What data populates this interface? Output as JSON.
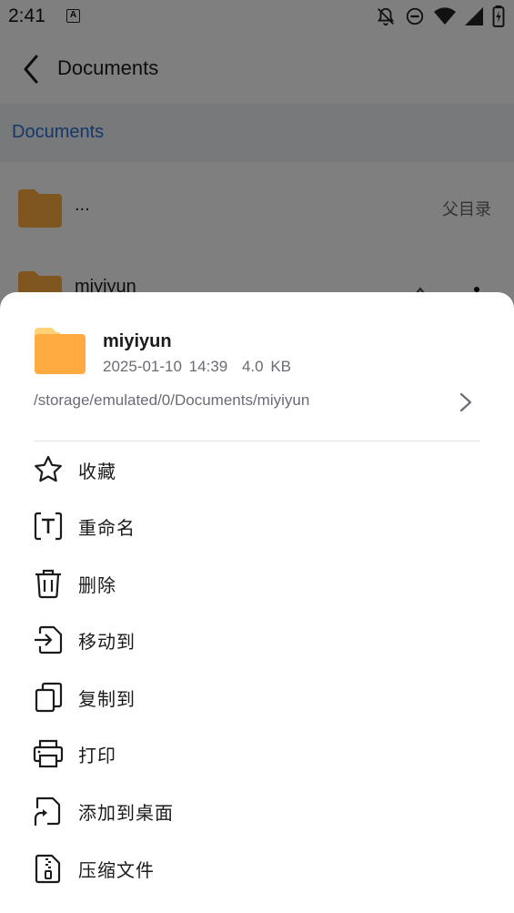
{
  "status_bar": {
    "time": "2:41",
    "notification_icon": "a-notification-icon",
    "icons": [
      "bell-off-icon",
      "dnd-icon",
      "wifi-icon",
      "signal-icon",
      "battery-icon"
    ]
  },
  "app_bar": {
    "title": "Documents",
    "back_icon": "back-arrow-icon"
  },
  "breadcrumb": {
    "current": "Documents"
  },
  "file_list": [
    {
      "name": "...",
      "trailing": "父目录"
    },
    {
      "name": "miyiyun",
      "trailing": ""
    }
  ],
  "sheet": {
    "name": "miyiyun",
    "date": "2025-01-10 14:39",
    "size": "4.0 KB",
    "path": "/storage/emulated/0/Documents/miyiyun",
    "items": [
      {
        "label": "收藏",
        "icon": "star-icon"
      },
      {
        "label": "重命名",
        "icon": "rename-icon"
      },
      {
        "label": "删除",
        "icon": "trash-icon"
      },
      {
        "label": "移动到",
        "icon": "move-icon"
      },
      {
        "label": "复制到",
        "icon": "copy-icon"
      },
      {
        "label": "打印",
        "icon": "printer-icon"
      },
      {
        "label": "添加到桌面",
        "icon": "shortcut-icon"
      },
      {
        "label": "压缩文件",
        "icon": "zip-icon"
      }
    ]
  },
  "colors": {
    "accent": "#2c6fd6",
    "folder": "#ffab40",
    "folder_tab": "#ffd27a"
  }
}
